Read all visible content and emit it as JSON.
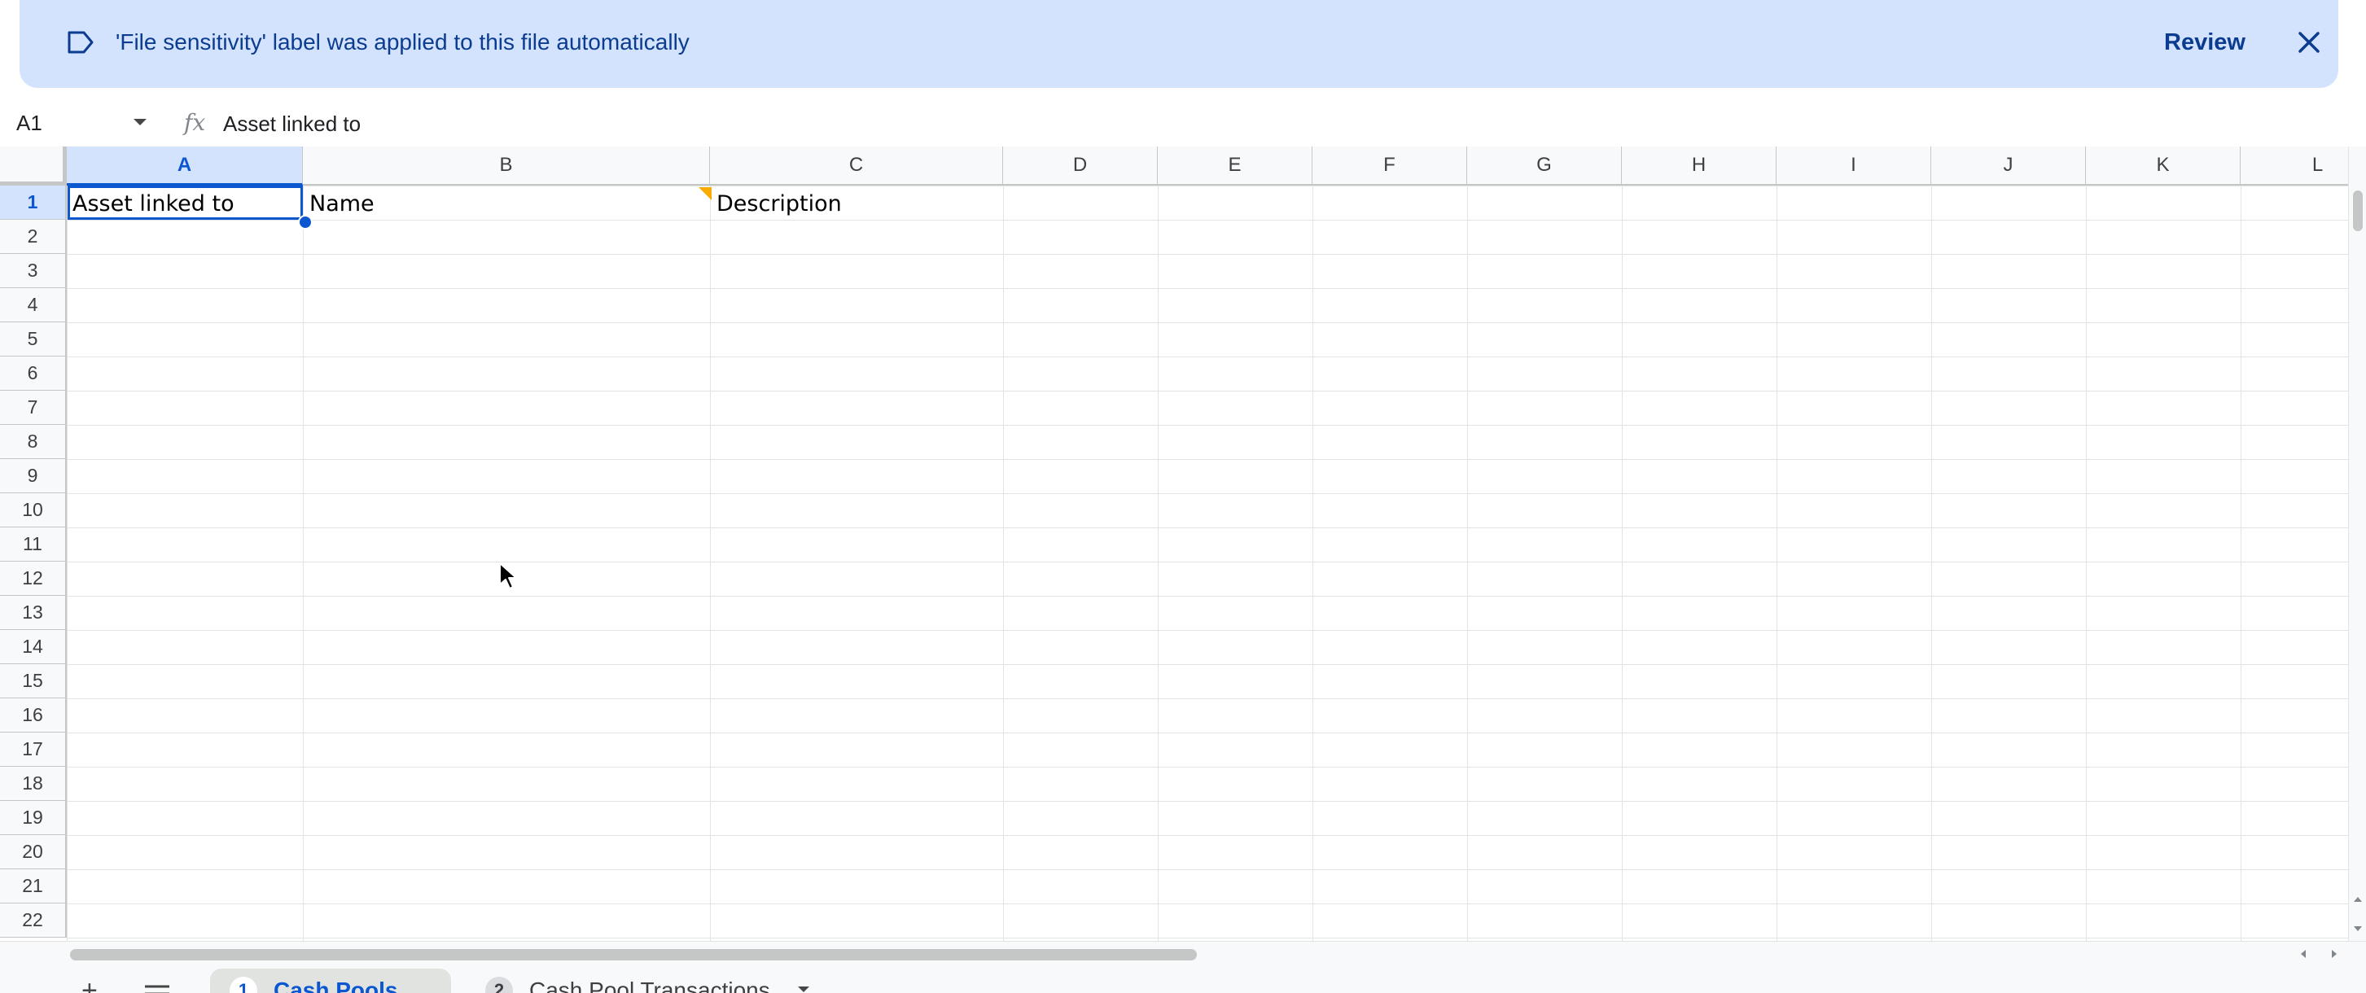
{
  "banner": {
    "message": "'File sensitivity' label was applied to this file automatically",
    "review_label": "Review",
    "icons": {
      "label": "label-outline-icon",
      "close": "close-icon"
    }
  },
  "formula_bar": {
    "name_box": "A1",
    "fx_symbol": "fx",
    "value": "Asset linked to"
  },
  "columns": [
    "A",
    "B",
    "C",
    "D",
    "E",
    "F",
    "G",
    "H",
    "I",
    "J",
    "K",
    "L"
  ],
  "rows": [
    "1",
    "2",
    "3",
    "4",
    "5",
    "6",
    "7",
    "8",
    "9",
    "10",
    "11",
    "12",
    "13",
    "14",
    "15",
    "16",
    "17",
    "18",
    "19",
    "20",
    "21",
    "22"
  ],
  "cells": {
    "A1": "Asset linked to",
    "B1": "Name",
    "C1": "Description"
  },
  "selected_cell": "A1",
  "sheet_tabs": [
    {
      "number": "1",
      "label": "Cash Pools",
      "active": true
    },
    {
      "number": "2",
      "label": "Cash Pool Transactions",
      "active": false
    }
  ],
  "colors": {
    "banner_bg": "#d3e3fd",
    "accent": "#0b57d0",
    "comment_marker": "#f9ab00"
  }
}
